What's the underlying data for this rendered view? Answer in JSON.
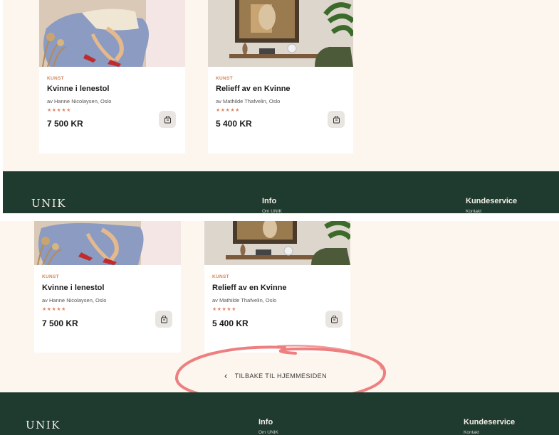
{
  "product_a": {
    "category": "KUNST",
    "title": "Kvinne i lenestol",
    "artist": "av Hanne Nicolaysen, Oslo",
    "stars": "★★★★★",
    "price": "7 500 KR"
  },
  "product_b": {
    "category": "KUNST",
    "title": "Relieff av en Kvinne",
    "artist": "av Mathilde Thafvelin, Oslo",
    "stars": "★★★★★",
    "price": "5 400 KR"
  },
  "footer": {
    "logo": "UNIK",
    "info_heading": "Info",
    "info_first_link": "Om UNIK",
    "service_heading": "Kundeservice",
    "service_first_link": "Kontakt"
  },
  "back_link": {
    "label": "TILBAKE TIL HJEMMESIDEN"
  },
  "colors": {
    "page_bg": "#fdf6ee",
    "footer_bg": "#1f3a2f",
    "accent": "#d0875a",
    "highlight_circle": "#ee7f80"
  }
}
